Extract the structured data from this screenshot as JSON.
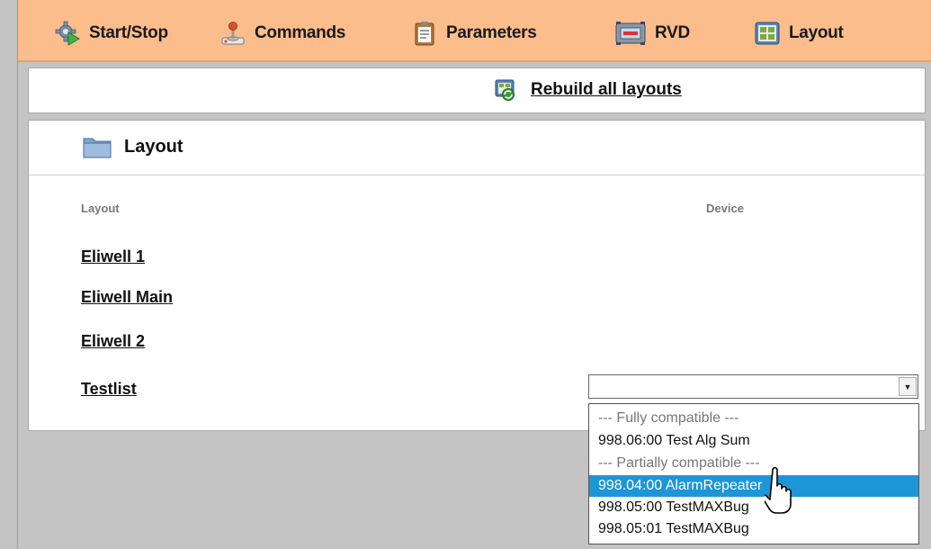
{
  "nav": {
    "items": [
      {
        "label": "Start/Stop",
        "icon": "gear-play-icon"
      },
      {
        "label": "Commands",
        "icon": "joystick-icon"
      },
      {
        "label": "Parameters",
        "icon": "clipboard-icon"
      },
      {
        "label": "RVD",
        "icon": "device-screen-icon"
      },
      {
        "label": "Layout",
        "icon": "layout-grid-icon"
      }
    ]
  },
  "rebuild": {
    "label": "Rebuild all layouts",
    "icon": "rebuild-icon"
  },
  "panel": {
    "title": "Layout",
    "col_layout": "Layout",
    "col_device": "Device",
    "rows": [
      "Eliwell 1",
      "Eliwell Main",
      "Eliwell 2",
      "Testlist"
    ]
  },
  "select": {
    "value": "",
    "options": [
      "--- Fully compatible ---",
      "998.06:00 Test Alg Sum",
      "--- Partially compatible ---",
      "998.04:00 AlarmRepeater",
      "998.05:00 TestMAXBug",
      "998.05:01 TestMAXBug"
    ],
    "highlighted_option": "998.04:00 AlarmRepeater"
  },
  "colors": {
    "nav_bg": "#fbbd8c",
    "highlight": "#1d96d8",
    "page_bg": "#c4c4c4"
  }
}
